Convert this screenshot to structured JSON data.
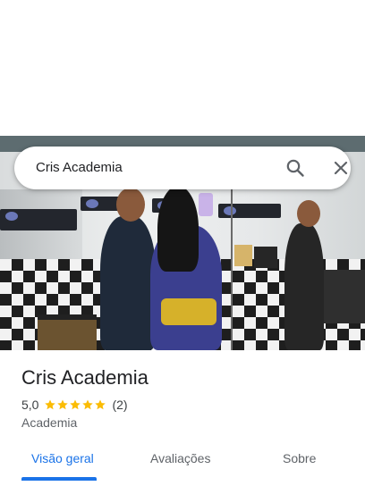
{
  "search": {
    "query": "Cris Academia"
  },
  "icons": {
    "search": "search-icon",
    "close": "close-icon",
    "star": "star-icon"
  },
  "place": {
    "name": "Cris Academia",
    "rating": "5,0",
    "stars": 5,
    "review_count": "(2)",
    "category": "Academia"
  },
  "tabs": [
    {
      "label": "Visão geral",
      "active": true
    },
    {
      "label": "Avaliações",
      "active": false
    },
    {
      "label": "Sobre",
      "active": false
    }
  ],
  "colors": {
    "accent": "#1a73e8",
    "star": "#fbbc04",
    "text_primary": "#202124",
    "text_secondary": "#5f6368"
  }
}
